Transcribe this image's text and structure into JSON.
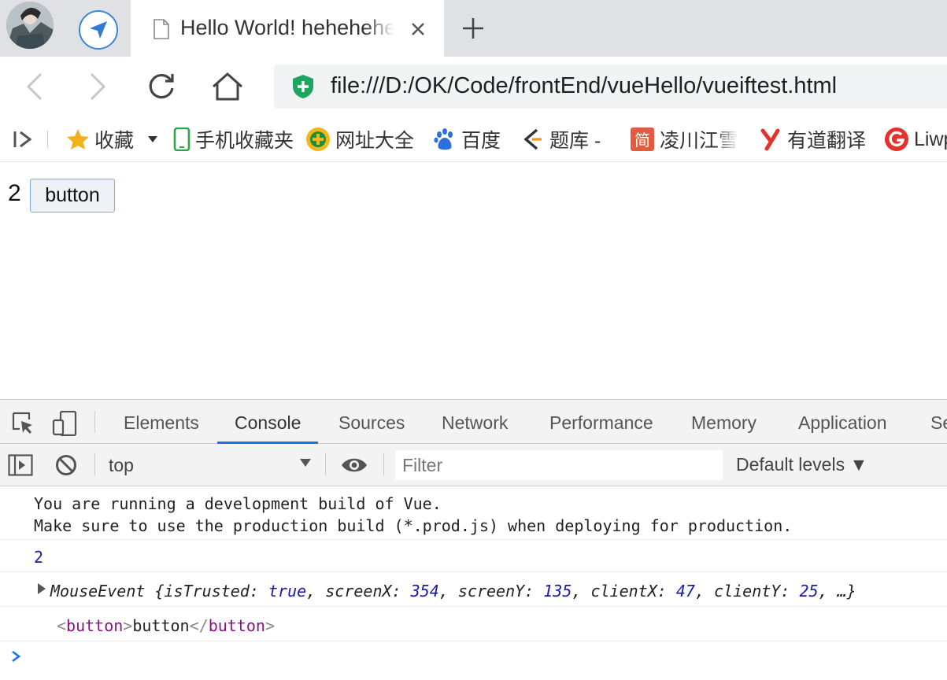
{
  "tab": {
    "title": "Hello World! hehehehehe"
  },
  "address": {
    "url": "file:///D:/OK/Code/frontEnd/vueHello/vueiftest.html"
  },
  "bookmarks": [
    {
      "label": "收藏",
      "icon": "star-icon"
    },
    {
      "label": "手机收藏夹",
      "icon": "phone-icon"
    },
    {
      "label": "网址大全",
      "icon": "directory-icon"
    },
    {
      "label": "百度",
      "icon": "baidu-paw-icon"
    },
    {
      "label": "题库 -",
      "icon": "question-bank-icon"
    },
    {
      "label": "凌川江雪",
      "icon": "jian-icon"
    },
    {
      "label": "有道翻译",
      "icon": "youdao-icon"
    },
    {
      "label": "Liwp",
      "icon": "g-logo-icon"
    }
  ],
  "page": {
    "count": "2",
    "button_label": "button"
  },
  "devtools": {
    "tabs": [
      "Elements",
      "Console",
      "Sources",
      "Network",
      "Performance",
      "Memory",
      "Application",
      "Se"
    ],
    "active_tab": "Console",
    "context": "top",
    "filter_placeholder": "Filter",
    "levels": "Default levels ▼",
    "messages": {
      "vue_line1": "You are running a development build of Vue.",
      "vue_line2": "Make sure to use the production build (*.prod.js) when deploying for production.",
      "count_log": "2",
      "event_log": {
        "type": "MouseEvent",
        "props": [
          {
            "key": "isTrusted",
            "value": "true"
          },
          {
            "key": "screenX",
            "value": "354"
          },
          {
            "key": "screenY",
            "value": "135"
          },
          {
            "key": "clientX",
            "value": "47"
          },
          {
            "key": "clientY",
            "value": "25"
          }
        ],
        "ellipsis": "…"
      },
      "element_log": {
        "tag": "button",
        "text": "button"
      }
    }
  },
  "colors": {
    "accent": "#1a73e8",
    "number": "#1a1aa6",
    "tag": "#881280",
    "secure": "#1da660"
  }
}
